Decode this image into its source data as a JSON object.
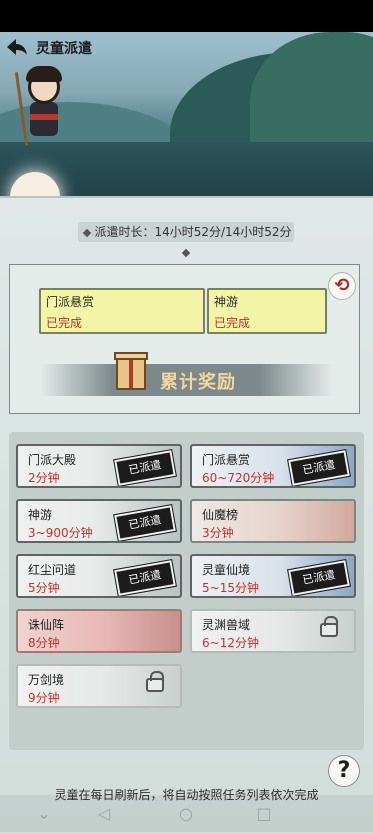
{
  "header": {
    "title": "灵童派遣"
  },
  "dispatch": {
    "duration_text": "派遣时长：14小时52分/14小时52分"
  },
  "completed_tasks": [
    {
      "name": "门派悬赏",
      "status": "已完成"
    },
    {
      "name": "神游",
      "status": "已完成"
    }
  ],
  "reward": {
    "label": "累计奖励"
  },
  "tasks": [
    {
      "name": "门派大殿",
      "time": "2分钟",
      "stamp": "已派遣"
    },
    {
      "name": "门派悬赏",
      "time": "60~720分钟",
      "stamp": "已派遣"
    },
    {
      "name": "神游",
      "time": "3~900分钟",
      "stamp": "已派遣"
    },
    {
      "name": "仙魔榜",
      "time": "3分钟"
    },
    {
      "name": "红尘问道",
      "time": "5分钟",
      "stamp": "已派遣"
    },
    {
      "name": "灵童仙境",
      "time": "5~15分钟",
      "stamp": "已派遣"
    },
    {
      "name": "诛仙阵",
      "time": "8分钟"
    },
    {
      "name": "灵渊兽域",
      "time": "6~12分钟"
    },
    {
      "name": "万剑境",
      "time": "9分钟"
    }
  ],
  "footer": {
    "notice": "灵童在每日刷新后，将自动按照任务列表依次完成",
    "help": "?"
  },
  "icons": {
    "back": "back-arrow-icon",
    "refresh": "refresh-icon",
    "gift": "gift-box-icon",
    "lock": "lock-icon"
  },
  "colors": {
    "completed_card": "#f3f5a6",
    "time_text": "#c2322a",
    "stamp": "#1c1c1c"
  }
}
